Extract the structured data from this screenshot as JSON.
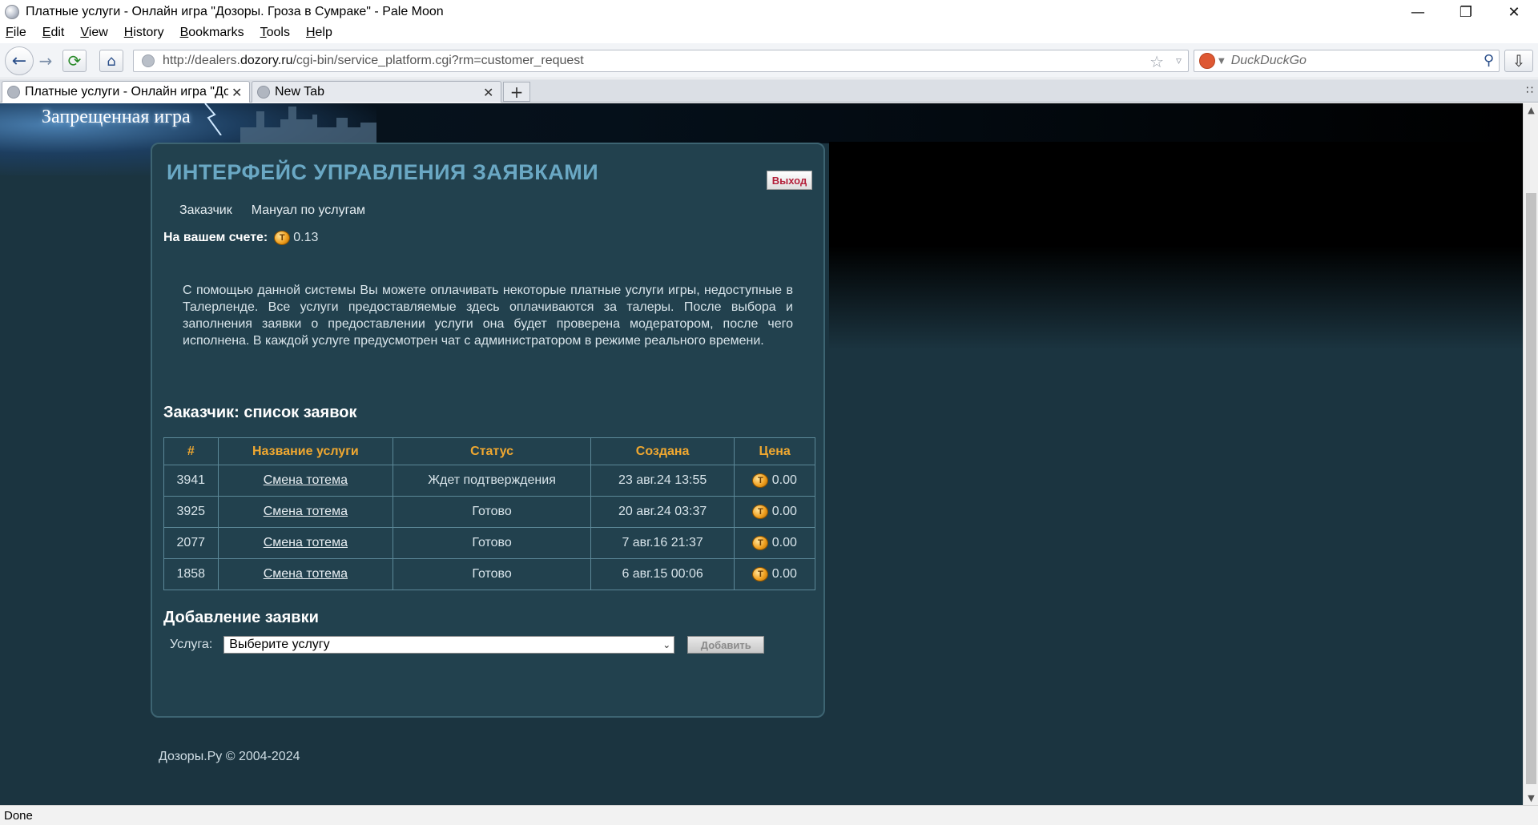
{
  "window": {
    "title": "Платные услуги - Онлайн игра \"Дозоры. Гроза в Сумраке\" - Pale Moon",
    "minimize": "—",
    "maximize": "❐",
    "close": "✕"
  },
  "menu": [
    {
      "first": "F",
      "rest": "ile"
    },
    {
      "first": "E",
      "rest": "dit"
    },
    {
      "first": "V",
      "rest": "iew"
    },
    {
      "first": "H",
      "rest": "istory"
    },
    {
      "first": "B",
      "rest": "ookmarks"
    },
    {
      "first": "T",
      "rest": "ools"
    },
    {
      "first": "H",
      "rest": "elp"
    }
  ],
  "nav": {
    "url_prefix": "http://dealers.",
    "url_host": "dozory.ru",
    "url_path": "/cgi-bin/service_platform.cgi?rm=customer_request",
    "search_placeholder": "DuckDuckGo",
    "icons": {
      "back": "back-arrow-icon",
      "forward": "forward-arrow-icon",
      "reload": "reload-icon",
      "home": "home-icon",
      "bookmark": "star-icon",
      "search": "magnifier-icon",
      "downloads": "download-icon"
    }
  },
  "tabs": [
    {
      "label": "Платные услуги - Онлайн игра \"Дозоры",
      "close": "✕"
    },
    {
      "label": "New Tab",
      "close": "✕"
    }
  ],
  "newtab_label": "+",
  "page": {
    "logo_text": "Запрещенная игра",
    "title": "ИНТЕРФЕЙС УПРАВЛЕНИЯ ЗАЯВКАМИ",
    "logout": "Выход",
    "nav": [
      "Заказчик",
      "Мануал по услугам"
    ],
    "balance_label": "На вашем счете:",
    "balance_value": "0.13",
    "intro": "С помощью данной системы Вы можете оплачивать некоторые платные услуги игры, недоступные в Талерленде. Все услуги предоставляемые здесь оплачиваются за талеры. После выбора и заполнения заявки о предоставлении услуги она будет проверена модератором, после чего исполнена. В каждой услуге предусмотрен чат с администратором в режиме реального времени.",
    "orders_heading": "Заказчик: список заявок",
    "table": {
      "headers": [
        "#",
        "Название услуги",
        "Статус",
        "Создана",
        "Цена"
      ],
      "rows": [
        {
          "id": "3941",
          "service": "Смена тотема",
          "status": "Ждет подтверждения",
          "created": "23 авг.24 13:55",
          "price": "0.00"
        },
        {
          "id": "3925",
          "service": "Смена тотема",
          "status": "Готово",
          "created": "20 авг.24 03:37",
          "price": "0.00"
        },
        {
          "id": "2077",
          "service": "Смена тотема",
          "status": "Готово",
          "created": "7 авг.16 21:37",
          "price": "0.00"
        },
        {
          "id": "1858",
          "service": "Смена тотема",
          "status": "Готово",
          "created": "6 авг.15 00:06",
          "price": "0.00"
        }
      ]
    },
    "add_heading": "Добавление заявки",
    "service_label": "Услуга:",
    "service_selected": "Выберите услугу",
    "add_button": "Добавить",
    "footer": "Дозоры.Ру © 2004-2024"
  },
  "status": "Done",
  "colors": {
    "page_bg": "#1b3440",
    "panel_bg": "#22414e",
    "title": "#6aa8c4",
    "table_header": "#f0a830",
    "logout_text": "#b4203a"
  }
}
